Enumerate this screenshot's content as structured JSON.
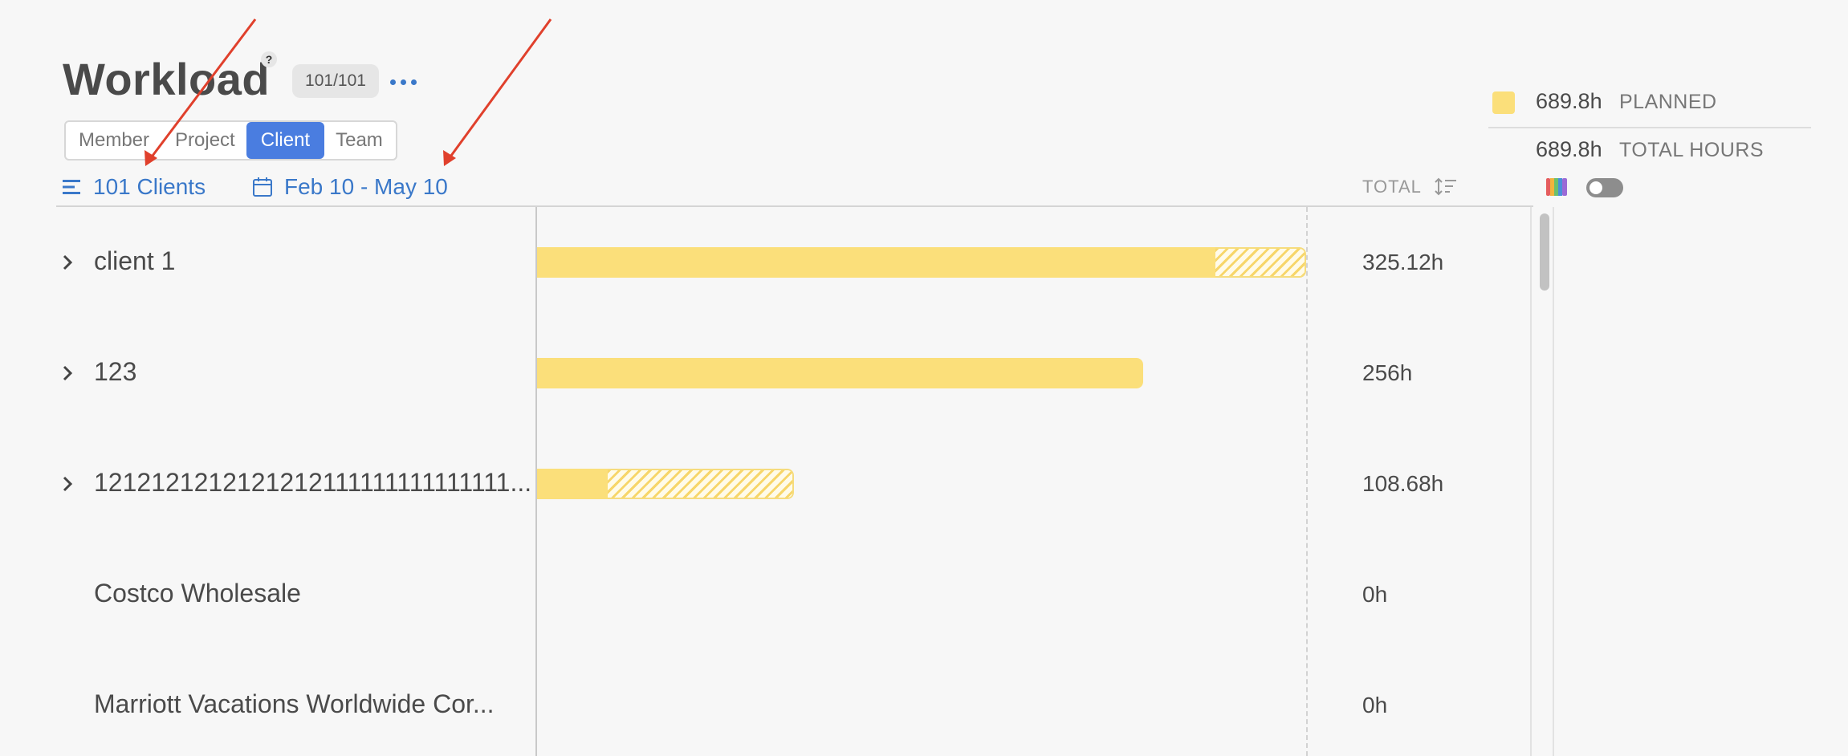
{
  "header": {
    "title": "Workload",
    "help_glyph": "?",
    "count_badge": "101/101",
    "more_icon": "ellipsis-icon"
  },
  "view_tabs": [
    {
      "label": "Member",
      "active": false
    },
    {
      "label": "Project",
      "active": false
    },
    {
      "label": "Client",
      "active": true
    },
    {
      "label": "Team",
      "active": false
    }
  ],
  "filters": {
    "clients_label": "101 Clients",
    "date_range": "Feb 10 - May 10"
  },
  "columns": {
    "total_header": "TOTAL"
  },
  "legend": {
    "planned_value": "689.8h",
    "planned_label": "PLANNED",
    "total_value": "689.8h",
    "total_label": "TOTAL HOURS",
    "planned_color": "#fbdf7a",
    "color_toggle_on": false
  },
  "rows": [
    {
      "name": "client 1",
      "total": "325.12h",
      "expandable": true,
      "planned_fraction": 0.882,
      "total_fraction": 1.0
    },
    {
      "name": "123",
      "total": "256h",
      "expandable": true,
      "planned_fraction": 0.788,
      "total_fraction": 0.788
    },
    {
      "name": "1212121212121212111111111111111...",
      "total": "108.68h",
      "expandable": true,
      "planned_fraction": 0.092,
      "total_fraction": 0.334
    },
    {
      "name": "Costco Wholesale",
      "total": "0h",
      "expandable": false,
      "planned_fraction": 0,
      "total_fraction": 0
    },
    {
      "name": "Marriott Vacations Worldwide Cor...",
      "total": "0h",
      "expandable": false,
      "planned_fraction": 0,
      "total_fraction": 0
    }
  ],
  "colors": {
    "accent": "#3a78c9",
    "active_tab": "#4a7de0",
    "annotation_arrow": "#e0402c",
    "bar": "#fbdf7a"
  }
}
